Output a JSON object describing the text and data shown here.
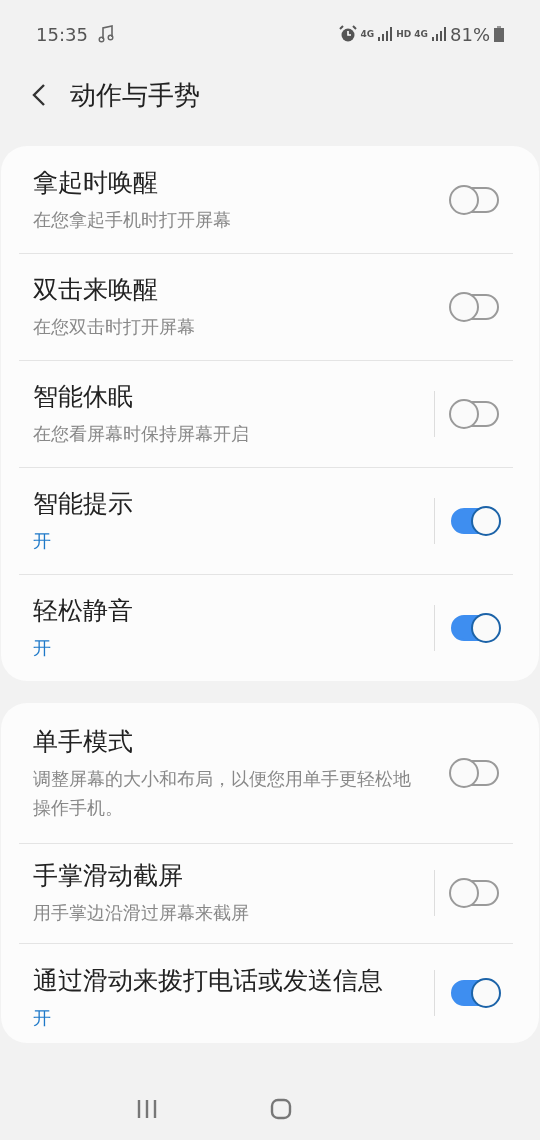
{
  "status_bar": {
    "time": "15:35",
    "signals": [
      {
        "label": "4G"
      },
      {
        "label": "HD 4G"
      }
    ],
    "battery": "81%"
  },
  "header": {
    "title": "动作与手势"
  },
  "groups": [
    {
      "items": [
        {
          "title": "拿起时唤醒",
          "subtitle": "在您拿起手机时打开屏幕",
          "on": false,
          "split": false
        },
        {
          "title": "双击来唤醒",
          "subtitle": "在您双击时打开屏幕",
          "on": false,
          "split": false
        },
        {
          "title": "智能休眠",
          "subtitle": "在您看屏幕时保持屏幕开启",
          "on": false,
          "split": true
        },
        {
          "title": "智能提示",
          "subtitle": "开",
          "on": true,
          "split": true
        },
        {
          "title": "轻松静音",
          "subtitle": "开",
          "on": true,
          "split": true
        }
      ]
    },
    {
      "items": [
        {
          "title": "单手模式",
          "subtitle": "调整屏幕的大小和布局，以便您用单手更轻松地操作手机。",
          "on": false,
          "split": false
        },
        {
          "title": "手掌滑动截屏",
          "subtitle": "用手掌边沿滑过屏幕来截屏",
          "on": false,
          "split": true
        },
        {
          "title": "通过滑动来拨打电话或发送信息",
          "subtitle": "开",
          "on": true,
          "split": true
        }
      ]
    }
  ]
}
